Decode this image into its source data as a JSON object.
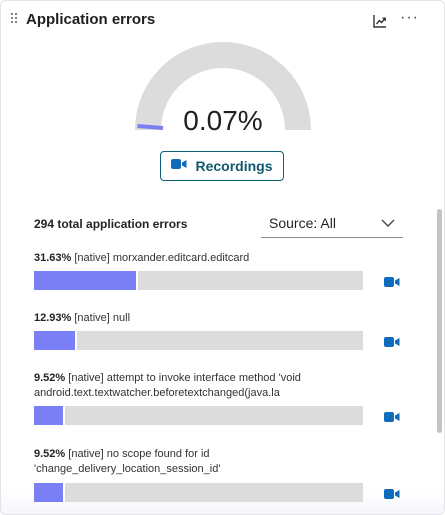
{
  "widget": {
    "title": "Application errors",
    "more_label": "···"
  },
  "gauge": {
    "value_label": "0.07%",
    "fraction": 0.0007,
    "track_color": "#dcdcdc",
    "fill_color": "#7b7ff5"
  },
  "recordings_button": {
    "label": "Recordings"
  },
  "summary": {
    "total_label": "294 total application errors",
    "source_label": "Source: All"
  },
  "errors": [
    {
      "percent": "31.63%",
      "message": "[native] morxander.editcard.editcard",
      "fraction": 0.3163
    },
    {
      "percent": "12.93%",
      "message": "[native] null",
      "fraction": 0.1293
    },
    {
      "percent": "9.52%",
      "message": "[native] attempt to invoke interface method 'void android.text.textwatcher.beforetextchanged(java.la",
      "fraction": 0.0952
    },
    {
      "percent": "9.52%",
      "message": "[native] no scope found for id 'change_delivery_location_session_id'",
      "fraction": 0.0952
    }
  ],
  "colors": {
    "accent": "#0f5970",
    "bar_fill": "#7b7ff5",
    "bar_track": "#dcdcdc",
    "camera_icon": "#0f6cbd"
  }
}
